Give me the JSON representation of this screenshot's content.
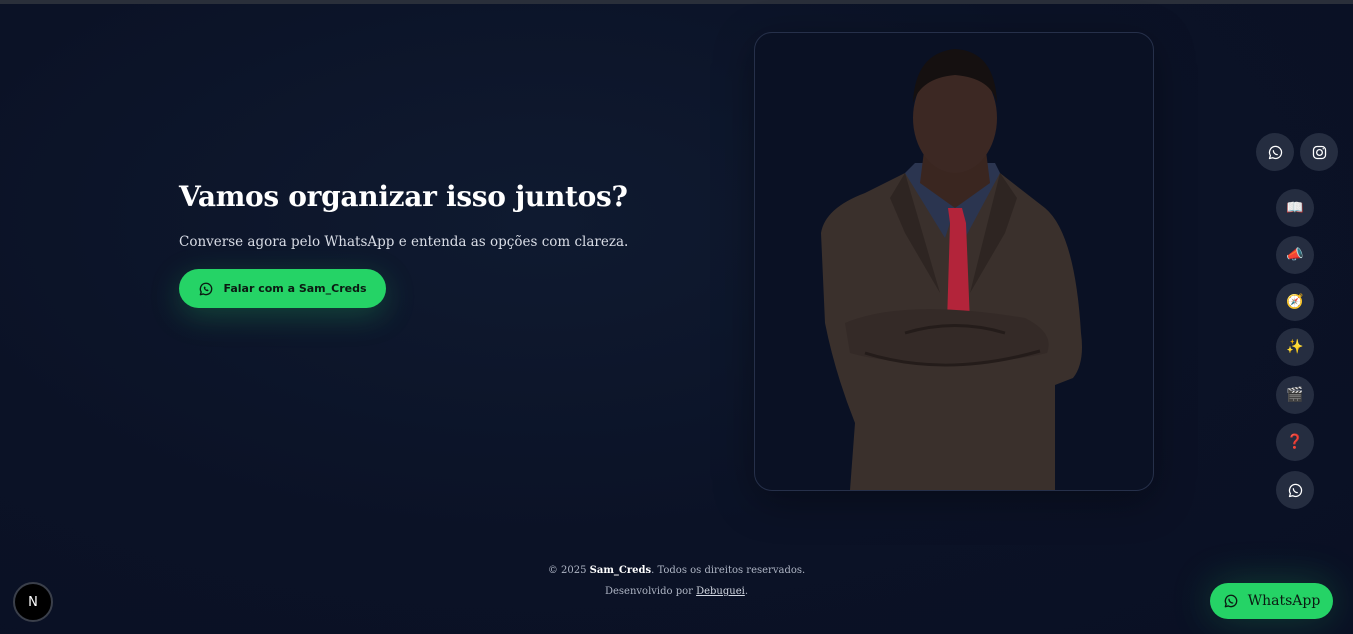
{
  "hero": {
    "title": "Vamos organizar isso juntos?",
    "subtitle": "Converse agora pelo WhatsApp e entenda as opções com clareza.",
    "cta_label": "Falar com a Sam_Creds"
  },
  "social": {
    "whatsapp_icon": "whatsapp-icon",
    "instagram_icon": "instagram-icon"
  },
  "side_nav": {
    "items": [
      {
        "icon": "📖",
        "name": "book-icon"
      },
      {
        "icon": "📣",
        "name": "megaphone-icon"
      },
      {
        "icon": "🧭",
        "name": "compass-icon"
      },
      {
        "icon": "✨",
        "name": "sparkles-icon"
      },
      {
        "icon": "🎬",
        "name": "clapper-icon"
      },
      {
        "icon": "❓",
        "name": "question-icon"
      },
      {
        "icon": "whatsapp",
        "name": "whatsapp-icon"
      }
    ]
  },
  "footer": {
    "copyright_prefix": "© 2025 ",
    "brand": "Sam_Creds",
    "copyright_suffix": ". Todos os direitos reservados.",
    "dev_prefix": "Desenvolvido por ",
    "dev_link": "Debuguei",
    "dev_suffix": "."
  },
  "next_badge": "N",
  "whatsapp_float_label": "WhatsApp",
  "colors": {
    "background": "#0b1226",
    "accent": "#25d366",
    "button_dark": "#252d40"
  }
}
